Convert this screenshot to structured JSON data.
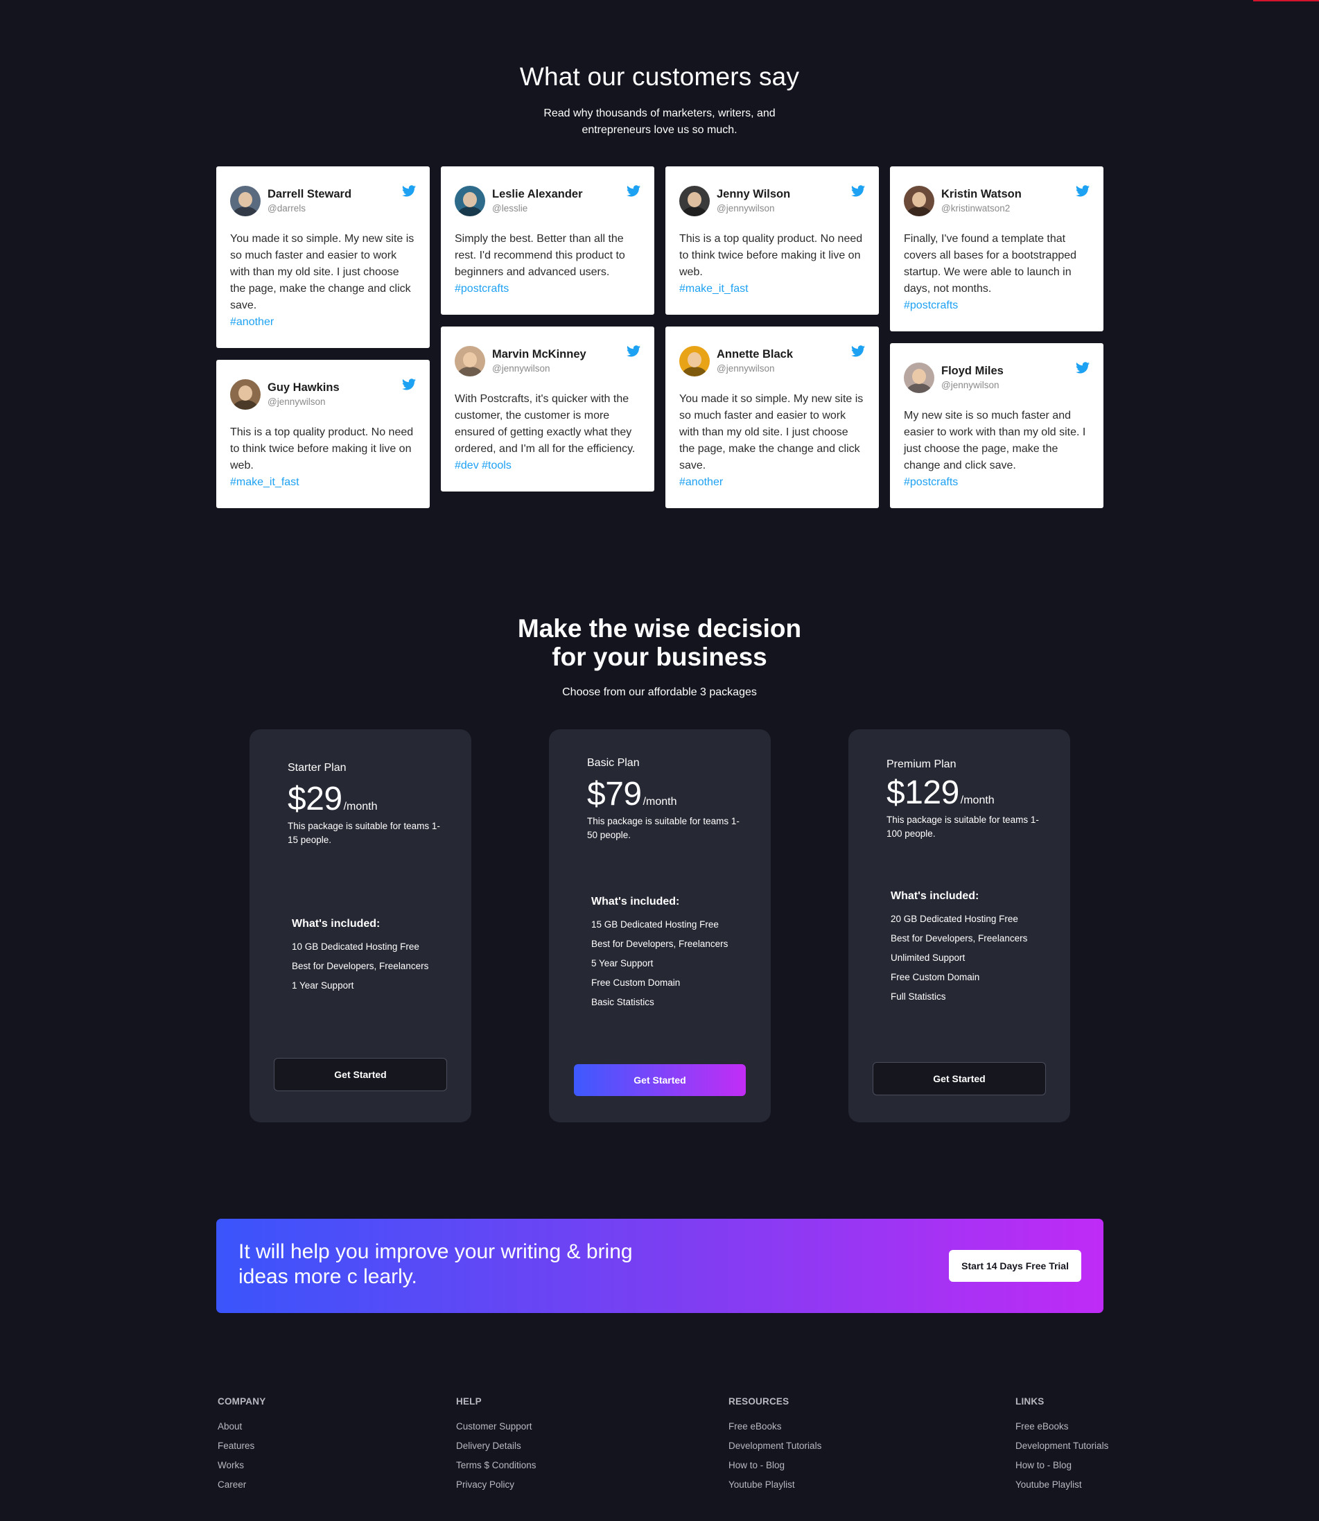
{
  "testimonials_section": {
    "title": "What our customers say",
    "subtitle": "Read why thousands of marketers, writers, and entrepreneurs love us so much."
  },
  "testimonials": [
    {
      "name": "Darrell Steward",
      "handle": "@darrels",
      "text": "You made it so simple. My new site is so much faster and easier to work with than my old site. I just choose the page, make the change and click save.",
      "tags": "#another",
      "avatar_color": "#5a6b80"
    },
    {
      "name": "Guy Hawkins",
      "handle": "@jennywilson",
      "text": "This is a top quality product. No need to think twice before making it live on web.",
      "tags": "#make_it_fast",
      "avatar_color": "#8a6a4a"
    },
    {
      "name": "Leslie Alexander",
      "handle": "@lesslie",
      "text": "Simply the best. Better than all the rest. I'd recommend this product to beginners and advanced users.",
      "tags": "#postcrafts",
      "avatar_color": "#2e6b8a"
    },
    {
      "name": "Marvin McKinney",
      "handle": "@jennywilson",
      "text": "With Postcrafts, it's quicker with the customer, the customer is more ensured of getting exactly what they ordered, and I'm all for the efficiency.",
      "tags": "#dev #tools",
      "avatar_color": "#c9a98a"
    },
    {
      "name": "Jenny Wilson",
      "handle": "@jennywilson",
      "text": "This is a top quality product. No need to think twice before making it live on web.",
      "tags": "#make_it_fast",
      "avatar_color": "#3a3a3a"
    },
    {
      "name": "Annette Black",
      "handle": "@jennywilson",
      "text": "You made it so simple. My new site is so much faster and easier to work with than my old site. I just choose the page, make the change and click save.",
      "tags": "#another",
      "avatar_color": "#e8a317"
    },
    {
      "name": "Kristin Watson",
      "handle": "@kristinwatson2",
      "text": "Finally, I've found a template that covers all bases for a bootstrapped startup. We were able to launch in days, not months.",
      "tags": "#postcrafts",
      "avatar_color": "#6b4a3a"
    },
    {
      "name": "Floyd Miles",
      "handle": "@jennywilson",
      "text": "My new site is so much faster and easier to work with than my old site. I just choose the page, make the change and click save.",
      "tags": "#postcrafts",
      "avatar_color": "#b8a6a0"
    }
  ],
  "pricing_section": {
    "title_line1": "Make the wise decision",
    "title_line2": "for your business",
    "subtitle": "Choose from our affordable 3 packages"
  },
  "plans": [
    {
      "name": "Starter Plan",
      "price": "$29",
      "period": "/month",
      "description": "This package is suitable for teams 1-15 people.",
      "included_title": "What's included:",
      "features": [
        "10 GB Dedicated Hosting Free",
        "Best for Developers, Freelancers",
        "1 Year Support"
      ],
      "button": "Get Started"
    },
    {
      "name": "Basic Plan",
      "price": "$79",
      "period": "/month",
      "description": "This package is suitable for teams 1-50 people.",
      "included_title": "What's included:",
      "features": [
        "15 GB Dedicated Hosting Free",
        "Best for Developers, Freelancers",
        "5 Year Support",
        "Free Custom Domain",
        "Basic Statistics"
      ],
      "button": "Get Started"
    },
    {
      "name": "Premium Plan",
      "price": "$129",
      "period": "/month",
      "description": "This package is suitable for teams 1-100 people.",
      "included_title": "What's included:",
      "features": [
        "20 GB Dedicated Hosting Free",
        "Best for Developers, Freelancers",
        "Unlimited Support",
        "Free Custom Domain",
        "Full Statistics"
      ],
      "button": "Get Started"
    }
  ],
  "cta": {
    "text": "It will help you improve your writing & bring ideas more c learly.",
    "button": "Start 14 Days Free Trial"
  },
  "footer": {
    "company": {
      "heading": "COMPANY",
      "links": [
        "About",
        "Features",
        "Works",
        "Career"
      ]
    },
    "help": {
      "heading": "HELP",
      "links": [
        "Customer Support",
        "Delivery Details",
        "Terms $ Conditions",
        "Privacy Policy"
      ]
    },
    "resources": {
      "heading": "RESOURCES",
      "links": [
        "Free eBooks",
        "Development Tutorials",
        "How to - Blog",
        "Youtube Playlist"
      ]
    },
    "links": {
      "heading": "LINKS",
      "links": [
        "Free eBooks",
        "Development Tutorials",
        "How to - Blog",
        "Youtube Playlist"
      ]
    }
  },
  "colors": {
    "background": "#13141d",
    "card_bg": "#262834",
    "twitter_blue": "#1da1f2",
    "gradient_start": "#3d5afe",
    "gradient_end": "#c22df5"
  },
  "icons": {
    "tweet": "twitter-bird-icon"
  }
}
